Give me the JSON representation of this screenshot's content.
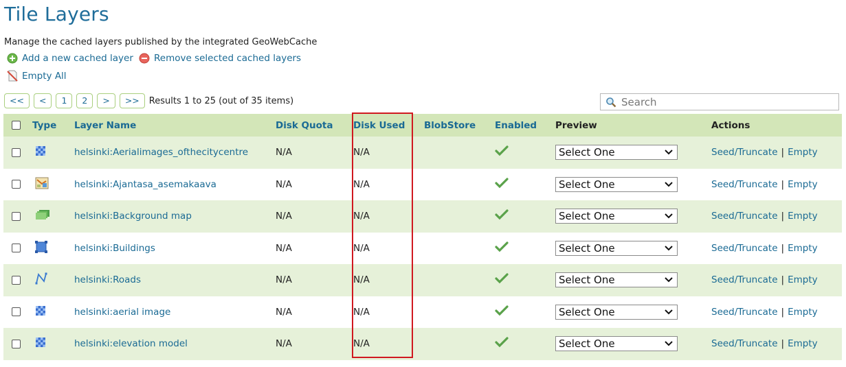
{
  "page": {
    "title": "Tile Layers",
    "description": "Manage the cached layers published by the integrated GeoWebCache"
  },
  "actions": {
    "add": {
      "label": "Add a new cached layer",
      "icon": "add-icon"
    },
    "remove": {
      "label": "Remove selected cached layers",
      "icon": "remove-icon"
    },
    "empty_all": {
      "label": "Empty All",
      "icon": "empty-all-icon"
    }
  },
  "pager": {
    "first": "<<",
    "prev": "<",
    "page1": "1",
    "page2": "2",
    "next": ">",
    "last": ">>",
    "results": "Results 1 to 25 (out of 35 items)"
  },
  "search": {
    "placeholder": "Search",
    "value": ""
  },
  "table": {
    "headers": {
      "type": "Type",
      "layer_name": "Layer Name",
      "disk_quota": "Disk Quota",
      "disk_used": "Disk Used",
      "blobstore": "BlobStore",
      "enabled": "Enabled",
      "preview": "Preview",
      "actions": "Actions"
    },
    "rows": [
      {
        "type_icon": "raster-icon",
        "name": "helsinki:Aerialimages_ofthecitycentre",
        "disk_quota": "N/A",
        "disk_used": "N/A",
        "blobstore": "",
        "enabled": true,
        "preview": "Select One",
        "seed": "Seed/Truncate",
        "sep": "|",
        "empty": "Empty"
      },
      {
        "type_icon": "layer-group-icon",
        "name": "helsinki:Ajantasa_asemakaava",
        "disk_quota": "N/A",
        "disk_used": "N/A",
        "blobstore": "",
        "enabled": true,
        "preview": "Select One",
        "seed": "Seed/Truncate",
        "sep": "|",
        "empty": "Empty"
      },
      {
        "type_icon": "layer-stack-icon",
        "name": "helsinki:Background map",
        "disk_quota": "N/A",
        "disk_used": "N/A",
        "blobstore": "",
        "enabled": true,
        "preview": "Select One",
        "seed": "Seed/Truncate",
        "sep": "|",
        "empty": "Empty"
      },
      {
        "type_icon": "polygon-icon",
        "name": "helsinki:Buildings",
        "disk_quota": "N/A",
        "disk_used": "N/A",
        "blobstore": "",
        "enabled": true,
        "preview": "Select One",
        "seed": "Seed/Truncate",
        "sep": "|",
        "empty": "Empty"
      },
      {
        "type_icon": "line-icon",
        "name": "helsinki:Roads",
        "disk_quota": "N/A",
        "disk_used": "N/A",
        "blobstore": "",
        "enabled": true,
        "preview": "Select One",
        "seed": "Seed/Truncate",
        "sep": "|",
        "empty": "Empty"
      },
      {
        "type_icon": "raster-icon",
        "name": "helsinki:aerial image",
        "disk_quota": "N/A",
        "disk_used": "N/A",
        "blobstore": "",
        "enabled": true,
        "preview": "Select One",
        "seed": "Seed/Truncate",
        "sep": "|",
        "empty": "Empty"
      },
      {
        "type_icon": "raster-icon",
        "name": "helsinki:elevation model",
        "disk_quota": "N/A",
        "disk_used": "N/A",
        "blobstore": "",
        "enabled": true,
        "preview": "Select One",
        "seed": "Seed/Truncate",
        "sep": "|",
        "empty": "Empty"
      }
    ]
  },
  "colors": {
    "link": "#1a6a94",
    "header_bg": "#d3e6b8",
    "alt_row_bg": "#e6f1d9",
    "check": "#5aa24a",
    "highlight_border": "#d0181f"
  }
}
